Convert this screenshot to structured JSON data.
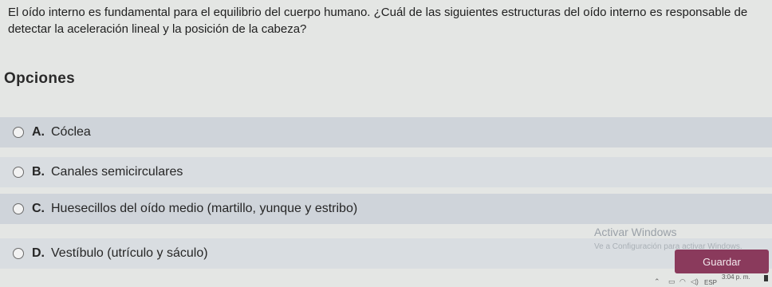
{
  "question": {
    "text": "El oído interno es fundamental para el equilibrio del cuerpo humano. ¿Cuál de las siguientes estructuras del oído interno es responsable de detectar la aceleración lineal y la posición de la cabeza?"
  },
  "options_title": "Opciones",
  "options": [
    {
      "letter": "A.",
      "text": "Cóclea"
    },
    {
      "letter": "B.",
      "text": "Canales semicirculares"
    },
    {
      "letter": "C.",
      "text": "Huesecillos del oído medio (martillo, yunque y estribo)"
    },
    {
      "letter": "D.",
      "text": "Vestíbulo (utrículo y sáculo)"
    }
  ],
  "watermark": {
    "title": "Activar Windows",
    "subtitle": "Ve a Configuración para activar Windows."
  },
  "save_label": "Guardar",
  "taskbar": {
    "language": "ESP",
    "time": "3:04 p. m."
  },
  "colors": {
    "save_button": "#8a3a5c",
    "option_background": "#cfd4da"
  }
}
